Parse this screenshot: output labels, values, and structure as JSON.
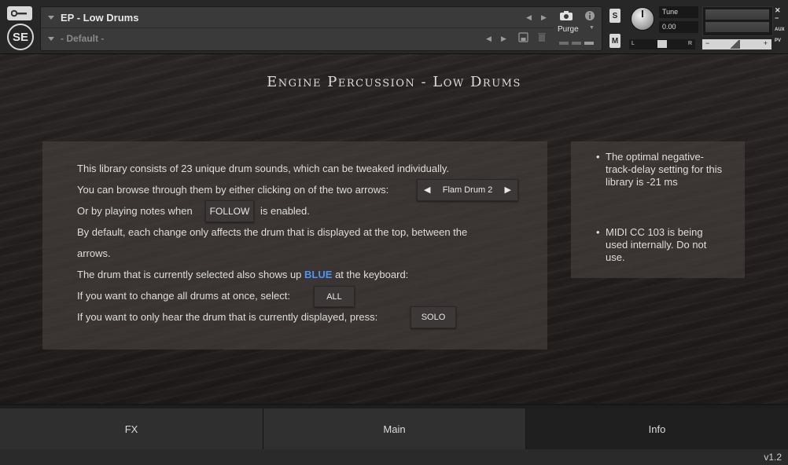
{
  "header": {
    "instrument_name": "EP - Low Drums",
    "preset_name": "- Default -",
    "purge_label": "Purge",
    "solo_btn": "S",
    "mute_btn": "M",
    "tune_label": "Tune",
    "tune_value": "0.00",
    "pan_left": "L",
    "pan_right": "R",
    "vol_minus": "−",
    "vol_plus": "+",
    "aux_label": "AUX",
    "pv_label": "PV",
    "logo": "SE"
  },
  "title": "Engine Percussion - Low Drums",
  "info": {
    "line1": "This library consists of 23 unique drum sounds, which can be tweaked individually.",
    "line2": "You can browse through them by either clicking on of the two arrows:",
    "drum_selector": "Flam Drum 2",
    "line3_a": "Or by playing notes when",
    "follow_btn": "FOLLOW",
    "line3_b": "is enabled.",
    "line4": "By default, each change only affects the drum that is displayed at the top, between the",
    "line5": "arrows.",
    "line6_a": "The drum that is currently selected also shows up",
    "line6_blue": "BLUE",
    "line6_b": "at the keyboard:",
    "line7": "If you want to change all drums at once, select:",
    "all_btn": "ALL",
    "line8": "If you want to only hear the drum that is currently displayed, press:",
    "solo_btn": "SOLO"
  },
  "notes": [
    "The optimal negative-track-delay setting for this library is -21 ms",
    "MIDI CC 103 is being used internally. Do not use."
  ],
  "tabs": [
    {
      "label": "FX"
    },
    {
      "label": "Main"
    },
    {
      "label": "Info"
    }
  ],
  "active_tab": "Info",
  "version": "v1.2",
  "colors": {
    "accent_blue": "#4d95f0"
  }
}
